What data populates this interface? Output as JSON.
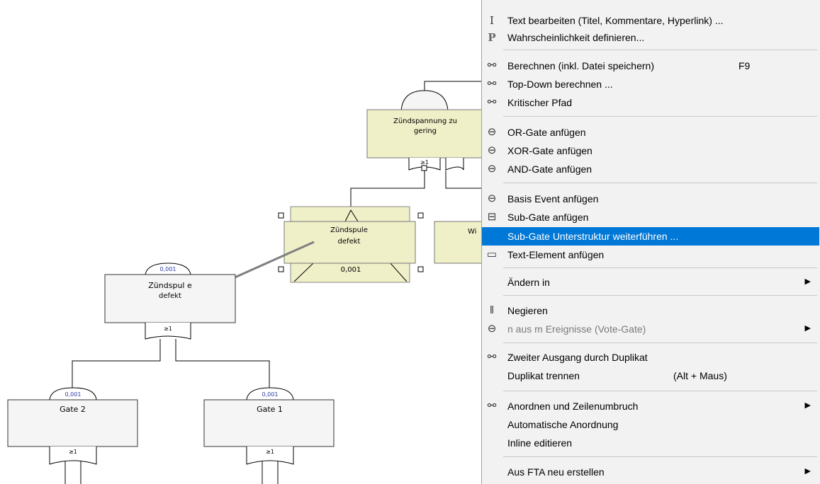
{
  "diagram": {
    "top_gate": {
      "label_line1": "Zündspannung zu",
      "label_line2": "gering",
      "gate_symbol": "≥1"
    },
    "selected_gate": {
      "label_line1": "Zündspule",
      "label_line2": "defekt",
      "probability": "0,001"
    },
    "partial_gate": {
      "label_fragment": "Wi"
    },
    "detail_gate": {
      "label_line1": "Zündspul e",
      "label_line2": "defekt",
      "probability": "0,001",
      "gate_symbol": "≥1"
    },
    "gate_2": {
      "label": "Gate 2",
      "probability": "0,001",
      "gate_symbol": "≥1"
    },
    "gate_1": {
      "label": "Gate 1",
      "probability": "0,001",
      "gate_symbol": "≥1"
    }
  },
  "context_menu": {
    "items": [
      {
        "icon": "text-cursor-icon",
        "glyph": "I",
        "label": "Text bearbeiten (Titel, Kommentare, Hyperlink) ..."
      },
      {
        "icon": "probability-icon",
        "glyph": "P",
        "label": "Wahrscheinlichkeit definieren..."
      },
      {
        "icon": "calculate-tree-icon",
        "glyph": "⚯",
        "label": "Berechnen  (inkl. Datei speichern)",
        "shortcut": "F9"
      },
      {
        "icon": "top-down-icon",
        "glyph": "⚯",
        "label": "Top-Down berechnen ..."
      },
      {
        "icon": "critical-path-icon",
        "glyph": "⚯",
        "label": "Kritischer Pfad"
      },
      {
        "icon": "or-gate-icon",
        "glyph": "⊖",
        "label": "OR-Gate anfügen"
      },
      {
        "icon": "xor-gate-icon",
        "glyph": "⊖",
        "label": "XOR-Gate anfügen"
      },
      {
        "icon": "and-gate-icon",
        "glyph": "⊖",
        "label": "AND-Gate anfügen"
      },
      {
        "icon": "basic-event-icon",
        "glyph": "⊖",
        "label": "Basis Event anfügen"
      },
      {
        "icon": "sub-gate-icon",
        "glyph": "⊟",
        "label": "Sub-Gate anfügen"
      },
      {
        "icon": "",
        "glyph": "",
        "label": "Sub-Gate Unterstruktur weiterführen ..."
      },
      {
        "icon": "text-element-icon",
        "glyph": "▭",
        "label": "Text-Element anfügen"
      },
      {
        "icon": "",
        "glyph": "",
        "label": "Ändern in",
        "submenu": true
      },
      {
        "icon": "negate-icon",
        "glyph": "ǁ",
        "label": "Negieren"
      },
      {
        "icon": "vote-gate-icon",
        "glyph": "⊖",
        "label": "n aus m Ereignisse (Vote-Gate)",
        "submenu": true
      },
      {
        "icon": "duplicate-output-icon",
        "glyph": "⚯",
        "label": "Zweiter Ausgang durch Duplikat"
      },
      {
        "icon": "",
        "glyph": "",
        "label": "Duplikat trennen",
        "shortcut": "(Alt + Maus)"
      },
      {
        "icon": "arrange-icon",
        "glyph": "⚯",
        "label": "Anordnen und Zeilenumbruch",
        "submenu": true
      },
      {
        "icon": "",
        "glyph": "",
        "label": "Automatische Anordnung"
      },
      {
        "icon": "",
        "glyph": "",
        "label": "Inline editieren"
      },
      {
        "icon": "",
        "glyph": "",
        "label": "Aus FTA neu erstellen",
        "submenu": true
      }
    ],
    "highlighted_index": 10,
    "disabled_indices": [
      14
    ],
    "highlight_color": "#0078d7"
  }
}
